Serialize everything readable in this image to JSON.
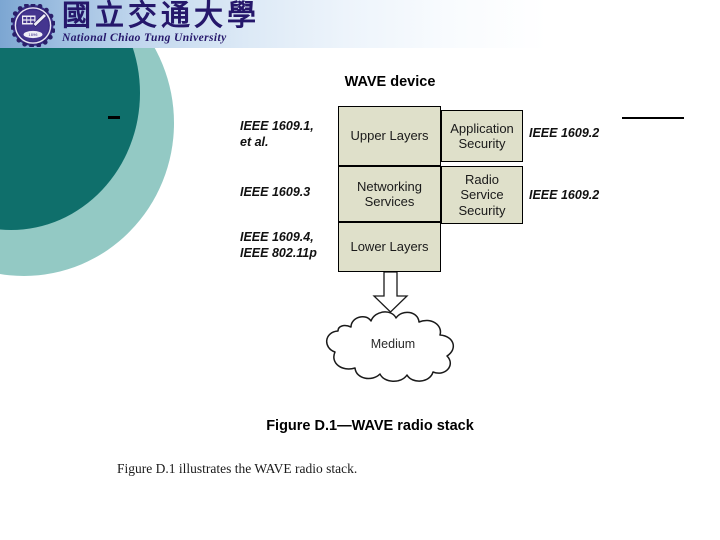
{
  "header": {
    "logo_icon": "university-seal-icon",
    "university_name_cn": "國立交通大學",
    "university_name_en": "National Chiao Tung University"
  },
  "slide": {
    "bullet_marker": "-",
    "top_rule": "horizontal-rule"
  },
  "figure": {
    "title": "WAVE device",
    "caption": "Figure D.1—WAVE radio stack",
    "body_text": "Figure D.1 illustrates the WAVE radio stack.",
    "boxes": [
      {
        "name": "upper-layers",
        "label": "Upper Layers"
      },
      {
        "name": "networking-services",
        "label": "Networking\nServices"
      },
      {
        "name": "lower-layers",
        "label": "Lower Layers"
      },
      {
        "name": "application-security",
        "label": "Application\nSecurity"
      },
      {
        "name": "radio-service-security",
        "label": "Radio\nService\nSecurity"
      }
    ],
    "box_labels": {
      "upper_layers": "Upper Layers",
      "networking_services_line1": "Networking",
      "networking_services_line2": "Services",
      "lower_layers": "Lower Layers",
      "application_security_line1": "Application",
      "application_security_line2": "Security",
      "radio_service_security_line1": "Radio",
      "radio_service_security_line2": "Service",
      "radio_service_security_line3": "Security"
    },
    "left_labels": {
      "upper_line1": "IEEE 1609.1,",
      "upper_line2": "et al.",
      "middle": "IEEE 1609.3",
      "lower_line1": "IEEE 1609.4,",
      "lower_line2": "IEEE 802.11p"
    },
    "right_labels": {
      "application_security": "IEEE 1609.2",
      "radio_service_security": "IEEE 1609.2"
    },
    "medium_label": "Medium",
    "arrow": "down-arrow-icon"
  },
  "colors": {
    "box_fill": "#dfe0ca",
    "box_border": "#000000",
    "circle_dark": "#0f6f6b",
    "circle_light": "#93c9c4",
    "header_blue": "#7ca6d2",
    "seal_purple": "#25176b"
  }
}
